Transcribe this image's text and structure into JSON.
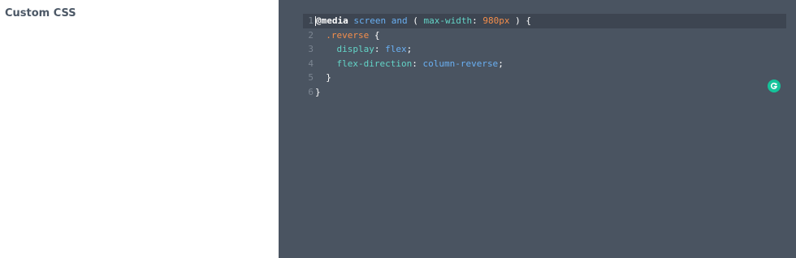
{
  "field": {
    "label": "Custom CSS"
  },
  "editor": {
    "lines": [
      {
        "number": "1",
        "tokens": [
          {
            "text": "@media",
            "type": "at"
          },
          {
            "text": " ",
            "type": "punc"
          },
          {
            "text": "screen",
            "type": "kw"
          },
          {
            "text": " ",
            "type": "punc"
          },
          {
            "text": "and",
            "type": "kw"
          },
          {
            "text": " ( ",
            "type": "punc"
          },
          {
            "text": "max-width",
            "type": "prop"
          },
          {
            "text": ": ",
            "type": "punc"
          },
          {
            "text": "980px",
            "type": "num"
          },
          {
            "text": " ) {",
            "type": "punc"
          }
        ]
      },
      {
        "number": "2",
        "tokens": [
          {
            "text": "  ",
            "type": "punc"
          },
          {
            "text": ".reverse",
            "type": "sel"
          },
          {
            "text": " {",
            "type": "punc"
          }
        ]
      },
      {
        "number": "3",
        "tokens": [
          {
            "text": "    ",
            "type": "punc"
          },
          {
            "text": "display",
            "type": "prop"
          },
          {
            "text": ": ",
            "type": "punc"
          },
          {
            "text": "flex",
            "type": "val"
          },
          {
            "text": ";",
            "type": "punc"
          }
        ]
      },
      {
        "number": "4",
        "tokens": [
          {
            "text": "    ",
            "type": "punc"
          },
          {
            "text": "flex-direction",
            "type": "prop"
          },
          {
            "text": ": ",
            "type": "punc"
          },
          {
            "text": "column-reverse",
            "type": "val"
          },
          {
            "text": ";",
            "type": "punc"
          }
        ]
      },
      {
        "number": "5",
        "tokens": [
          {
            "text": "  }",
            "type": "punc"
          }
        ]
      },
      {
        "number": "6",
        "tokens": [
          {
            "text": "}",
            "type": "punc"
          }
        ]
      }
    ]
  },
  "colors": {
    "editor_bg": "#4a5461",
    "active_line_bg": "#3d4551",
    "keyword": "#6ab0f3",
    "property": "#63d4c7",
    "number": "#f58e4b",
    "grammarly_badge": "#15c39a"
  },
  "icons": {
    "grammarly": "grammarly-icon"
  }
}
